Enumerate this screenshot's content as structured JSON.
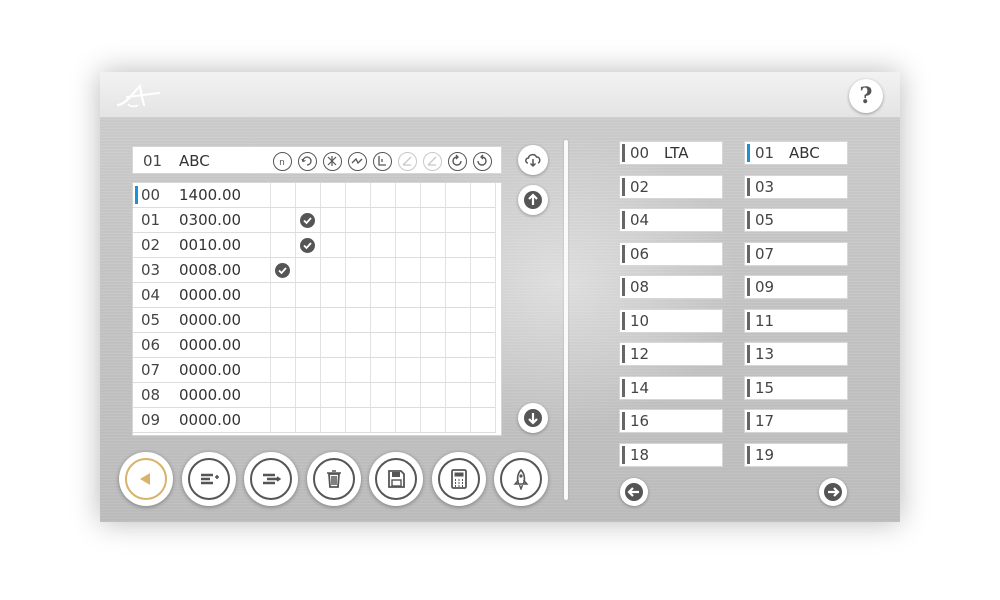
{
  "header": {
    "help_label": "?"
  },
  "program": {
    "number": "01",
    "name": "ABC"
  },
  "toolbar_icons": [
    {
      "name": "mode-n-icon",
      "dim": false
    },
    {
      "name": "rotate-icon",
      "dim": false
    },
    {
      "name": "cross-icon",
      "dim": false
    },
    {
      "name": "bend-icon",
      "dim": false
    },
    {
      "name": "step-icon",
      "dim": false
    },
    {
      "name": "angle-check-icon",
      "dim": true
    },
    {
      "name": "angle-icon",
      "dim": true
    },
    {
      "name": "rotate-cw-icon",
      "dim": false
    },
    {
      "name": "rotate-ccw-icon",
      "dim": false
    }
  ],
  "table": {
    "selected_index": 0,
    "rows": [
      {
        "index": "00",
        "value": "1400.00",
        "check_col": null
      },
      {
        "index": "01",
        "value": "0300.00",
        "check_col": 2
      },
      {
        "index": "02",
        "value": "0010.00",
        "check_col": 2
      },
      {
        "index": "03",
        "value": "0008.00",
        "check_col": 1
      },
      {
        "index": "04",
        "value": "0000.00",
        "check_col": null
      },
      {
        "index": "05",
        "value": "0000.00",
        "check_col": null
      },
      {
        "index": "06",
        "value": "0000.00",
        "check_col": null
      },
      {
        "index": "07",
        "value": "0000.00",
        "check_col": null
      },
      {
        "index": "08",
        "value": "0000.00",
        "check_col": null
      },
      {
        "index": "09",
        "value": "0000.00",
        "check_col": null
      }
    ]
  },
  "bottom_buttons": [
    {
      "name": "back-button",
      "icon": "triangle-left-icon",
      "active": true
    },
    {
      "name": "insert-line-button",
      "icon": "insert-line-icon",
      "active": false
    },
    {
      "name": "move-line-button",
      "icon": "move-line-icon",
      "active": false
    },
    {
      "name": "delete-button",
      "icon": "trash-icon",
      "active": false
    },
    {
      "name": "save-button",
      "icon": "floppy-icon",
      "active": false
    },
    {
      "name": "calculator-button",
      "icon": "calculator-icon",
      "active": false
    },
    {
      "name": "run-button",
      "icon": "rocket-icon",
      "active": false
    }
  ],
  "programs": {
    "selected": "01",
    "slots": [
      {
        "index": "00",
        "name": "LTA"
      },
      {
        "index": "01",
        "name": "ABC"
      },
      {
        "index": "02",
        "name": ""
      },
      {
        "index": "03",
        "name": ""
      },
      {
        "index": "04",
        "name": ""
      },
      {
        "index": "05",
        "name": ""
      },
      {
        "index": "06",
        "name": ""
      },
      {
        "index": "07",
        "name": ""
      },
      {
        "index": "08",
        "name": ""
      },
      {
        "index": "09",
        "name": ""
      },
      {
        "index": "10",
        "name": ""
      },
      {
        "index": "11",
        "name": ""
      },
      {
        "index": "12",
        "name": ""
      },
      {
        "index": "13",
        "name": ""
      },
      {
        "index": "14",
        "name": ""
      },
      {
        "index": "15",
        "name": ""
      },
      {
        "index": "16",
        "name": ""
      },
      {
        "index": "17",
        "name": ""
      },
      {
        "index": "18",
        "name": ""
      },
      {
        "index": "19",
        "name": ""
      }
    ]
  },
  "colors": {
    "selection": "#1e90d6",
    "active_ring": "#d7b36b",
    "icon": "#555555"
  }
}
